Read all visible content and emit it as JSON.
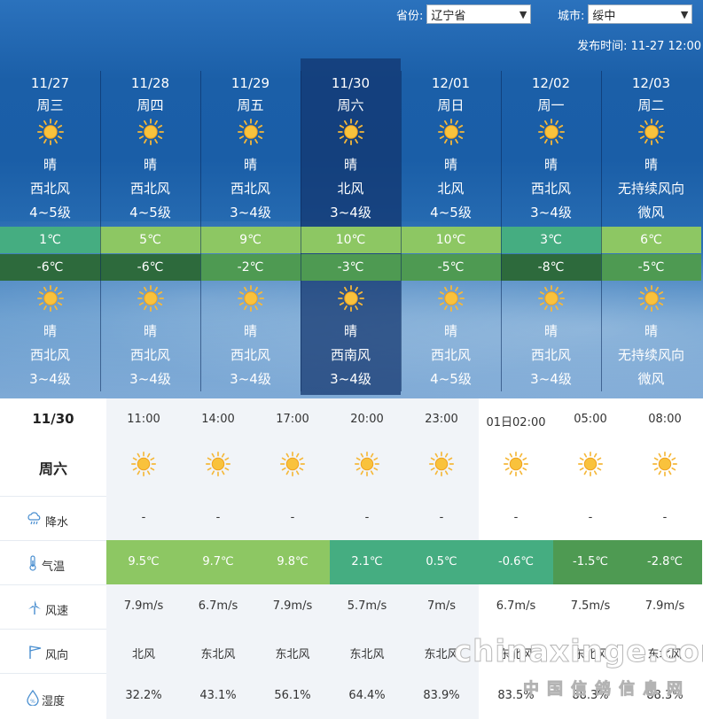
{
  "header": {
    "province_label": "省份:",
    "province_value": "辽宁省",
    "city_label": "城市:",
    "city_value": "绥中",
    "publish_label": "发布时间:",
    "publish_value": "11-27 12:00"
  },
  "days": [
    {
      "date": "11/27",
      "weekday": "周三",
      "day_weather": "晴",
      "day_wind_dir": "西北风",
      "day_wind_level": "4~5级",
      "high": "1℃",
      "low": "-6℃",
      "night_weather": "晴",
      "night_wind_dir": "西北风",
      "night_wind_level": "3~4级",
      "high_color": "#45ad81",
      "low_color": "#2d6a3c"
    },
    {
      "date": "11/28",
      "weekday": "周四",
      "day_weather": "晴",
      "day_wind_dir": "西北风",
      "day_wind_level": "4~5级",
      "high": "5℃",
      "low": "-6℃",
      "night_weather": "晴",
      "night_wind_dir": "西北风",
      "night_wind_level": "3~4级",
      "high_color": "#8dc763",
      "low_color": "#2d6a3c"
    },
    {
      "date": "11/29",
      "weekday": "周五",
      "day_weather": "晴",
      "day_wind_dir": "西北风",
      "day_wind_level": "3~4级",
      "high": "9℃",
      "low": "-2℃",
      "night_weather": "晴",
      "night_wind_dir": "西北风",
      "night_wind_level": "3~4级",
      "high_color": "#8dc763",
      "low_color": "#4e9a52"
    },
    {
      "date": "11/30",
      "weekday": "周六",
      "day_weather": "晴",
      "day_wind_dir": "北风",
      "day_wind_level": "3~4级",
      "high": "10℃",
      "low": "-3℃",
      "night_weather": "晴",
      "night_wind_dir": "西南风",
      "night_wind_level": "3~4级",
      "high_color": "#8dc763",
      "low_color": "#4e9a52"
    },
    {
      "date": "12/01",
      "weekday": "周日",
      "day_weather": "晴",
      "day_wind_dir": "北风",
      "day_wind_level": "4~5级",
      "high": "10℃",
      "low": "-5℃",
      "night_weather": "晴",
      "night_wind_dir": "西北风",
      "night_wind_level": "4~5级",
      "high_color": "#8dc763",
      "low_color": "#4e9a52"
    },
    {
      "date": "12/02",
      "weekday": "周一",
      "day_weather": "晴",
      "day_wind_dir": "西北风",
      "day_wind_level": "3~4级",
      "high": "3℃",
      "low": "-8℃",
      "night_weather": "晴",
      "night_wind_dir": "西北风",
      "night_wind_level": "3~4级",
      "high_color": "#45ad81",
      "low_color": "#2d6a3c"
    },
    {
      "date": "12/03",
      "weekday": "周二",
      "day_weather": "晴",
      "day_wind_dir": "无持续风向",
      "day_wind_level": "微风",
      "high": "6℃",
      "low": "-5℃",
      "night_weather": "晴",
      "night_wind_dir": "无持续风向",
      "night_wind_level": "微风",
      "high_color": "#8dc763",
      "low_color": "#4e9a52"
    }
  ],
  "selected_day_index": 3,
  "hourly": {
    "date": "11/30",
    "weekday": "周六",
    "row_labels": {
      "precip": "降水",
      "temp": "气温",
      "wind_speed": "风速",
      "wind_dir": "风向",
      "humidity": "湿度"
    },
    "columns": [
      {
        "time": "11:00",
        "precip": "-",
        "temp": "9.5℃",
        "wind_speed": "7.9m/s",
        "wind_dir": "北风",
        "humidity": "32.2%",
        "temp_color": "#8dc763"
      },
      {
        "time": "14:00",
        "precip": "-",
        "temp": "9.7℃",
        "wind_speed": "6.7m/s",
        "wind_dir": "东北风",
        "humidity": "43.1%",
        "temp_color": "#8dc763"
      },
      {
        "time": "17:00",
        "precip": "-",
        "temp": "9.8℃",
        "wind_speed": "7.9m/s",
        "wind_dir": "东北风",
        "humidity": "56.1%",
        "temp_color": "#8dc763"
      },
      {
        "time": "20:00",
        "precip": "-",
        "temp": "2.1℃",
        "wind_speed": "5.7m/s",
        "wind_dir": "东北风",
        "humidity": "64.4%",
        "temp_color": "#45ad81"
      },
      {
        "time": "23:00",
        "precip": "-",
        "temp": "0.5℃",
        "wind_speed": "7m/s",
        "wind_dir": "东北风",
        "humidity": "83.9%",
        "temp_color": "#45ad81"
      },
      {
        "time": "01日02:00",
        "precip": "-",
        "temp": "-0.6℃",
        "wind_speed": "6.7m/s",
        "wind_dir": "东北风",
        "humidity": "83.5%",
        "temp_color": "#45ad81"
      },
      {
        "time": "05:00",
        "precip": "-",
        "temp": "-1.5℃",
        "wind_speed": "7.5m/s",
        "wind_dir": "东北风",
        "humidity": "88.3%",
        "temp_color": "#4e9a52"
      },
      {
        "time": "08:00",
        "precip": "-",
        "temp": "-2.8℃",
        "wind_speed": "7.9m/s",
        "wind_dir": "东北风",
        "humidity": "88.3%",
        "temp_color": "#4e9a52"
      }
    ]
  },
  "watermark": {
    "line1": "chinaxinge.com",
    "line2": "中国信鸽信息网"
  },
  "icons": {
    "weather": "sun-icon",
    "precip": "rain-cloud-icon",
    "temp": "thermometer-icon",
    "wind_speed": "windmill-icon",
    "wind_dir": "wind-vane-icon",
    "humidity": "droplet-icon"
  }
}
